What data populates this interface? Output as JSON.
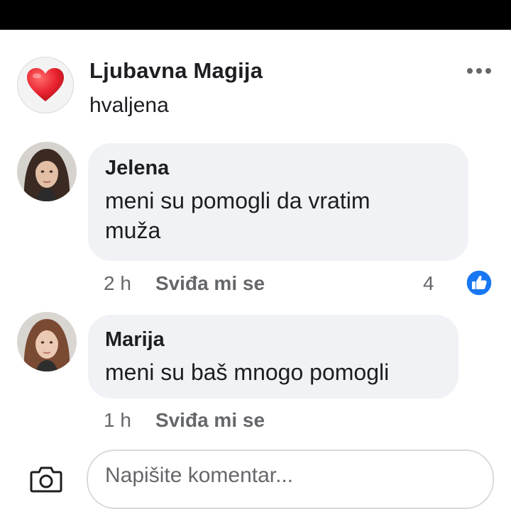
{
  "post": {
    "page_name": "Ljubavna Magija",
    "text": "hvaljena",
    "avatar_icon": "heart-icon"
  },
  "comments": [
    {
      "author": "Jelena",
      "text_line1": "meni su pomogli da vratim",
      "text_line2": "muža",
      "time": "2 h",
      "like_label": "Sviđa mi se",
      "reaction_count": "4",
      "reaction_icon": "like-thumb-icon"
    },
    {
      "author": "Marija",
      "text_line1": "meni su baš mnogo pomogli",
      "time": "1 h",
      "like_label": "Sviđa mi se"
    }
  ],
  "composer": {
    "placeholder": "Napišite komentar..."
  },
  "colors": {
    "bubble": "#f0f2f5",
    "secondary_text": "#65676b",
    "like_blue": "#1877f2",
    "heart_red": "#e8232f"
  }
}
